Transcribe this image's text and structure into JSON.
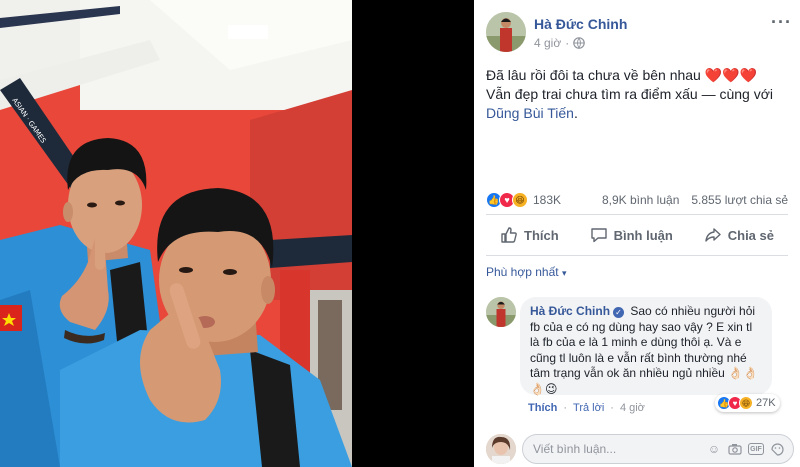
{
  "post": {
    "author": "Hà Đức Chinh",
    "time": "4 giờ",
    "more_icon": "···",
    "text_line1": "Đã lâu rồi đôi ta chưa về bên nhau",
    "text_hearts": "❤️❤️❤️",
    "text_line2_prefix": "Vẫn đẹp trai chưa tìm ra điểm xấu — cùng với ",
    "tagged_person": "Dũng Bùi Tiến",
    "text_end": "."
  },
  "stats": {
    "reactions_count": "183K",
    "comments": "8,9K bình luận",
    "shares": "5.855 lượt chia sẻ"
  },
  "actions": {
    "like": "Thích",
    "comment": "Bình luận",
    "share": "Chia sẻ"
  },
  "sort": {
    "label": "Phù hợp nhất",
    "caret": "▾"
  },
  "comment": {
    "author": "Hà Đức Chinh",
    "text": "Sao có nhiều người hỏi fb của e có ng dùng hay sao vậy ? E xin tl là fb của e là 1 minh e dùng thôi ạ. Và e cũng tl luôn là e vẫn rất bình thường nhé tâm trạng vẫn ok ăn nhiều ngủ nhiều 👌🏻👌🏻👌🏻😉",
    "reactions_count": "27K",
    "like": "Thích",
    "reply": "Trả lời",
    "time": "4 giờ"
  },
  "composer": {
    "placeholder": "Viết bình luận..."
  },
  "colors": {
    "link": "#365899",
    "muted": "#90949c",
    "like_blue": "#1877f2",
    "love_red": "#f0284a",
    "haha_yellow": "#f7b125",
    "wall_red": "#e8473a",
    "jersey_blue": "#3b9ee0"
  },
  "icons": {
    "globe": "globe-icon",
    "like": "thumbs-up-icon",
    "comment": "speech-bubble-icon",
    "share": "share-arrow-icon",
    "emoji": "smiley-icon",
    "camera": "camera-icon",
    "gif": "GIF",
    "sticker": "sticker-icon"
  }
}
